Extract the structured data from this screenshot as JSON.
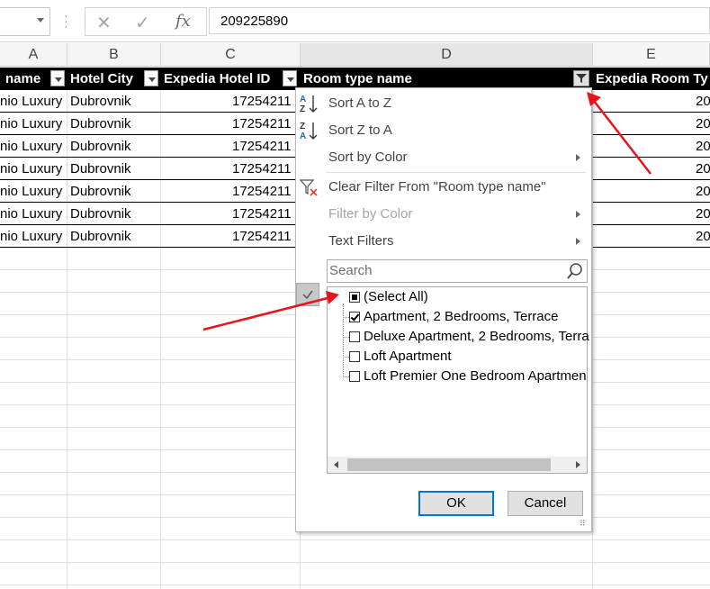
{
  "formula_bar": {
    "name_box_value": "",
    "cancel_icon": "close-icon",
    "enter_icon": "check-icon",
    "fx_label": "fx",
    "content": "209225890"
  },
  "columns": [
    "A",
    "B",
    "C",
    "D",
    "E"
  ],
  "table_headers": {
    "a": "name",
    "b": "Hotel City",
    "c": "Expedia Hotel ID",
    "d": "Room type name",
    "e": "Expedia Room Ty"
  },
  "rows": [
    {
      "a": "nio Luxury",
      "b": "Dubrovnik",
      "c": "17254211",
      "e": "20"
    },
    {
      "a": "nio Luxury",
      "b": "Dubrovnik",
      "c": "17254211",
      "e": "20"
    },
    {
      "a": "nio Luxury",
      "b": "Dubrovnik",
      "c": "17254211",
      "e": "20"
    },
    {
      "a": "nio Luxury",
      "b": "Dubrovnik",
      "c": "17254211",
      "e": "20"
    },
    {
      "a": "nio Luxury",
      "b": "Dubrovnik",
      "c": "17254211",
      "e": "20"
    },
    {
      "a": "nio Luxury",
      "b": "Dubrovnik",
      "c": "17254211",
      "e": "20"
    },
    {
      "a": "nio Luxury",
      "b": "Dubrovnik",
      "c": "17254211",
      "e": "20"
    }
  ],
  "filter_menu": {
    "sort_az": "Sort A to Z",
    "sort_za": "Sort Z to A",
    "sort_by_color": "Sort by Color",
    "clear_filter": "Clear Filter From \"Room type name\"",
    "filter_by_color": "Filter by Color",
    "text_filters": "Text Filters",
    "search_placeholder": "Search",
    "items": [
      {
        "label": "(Select All)",
        "state": "partial"
      },
      {
        "label": "Apartment, 2 Bedrooms, Terrace",
        "state": "checked"
      },
      {
        "label": "Deluxe Apartment, 2 Bedrooms, Terra",
        "state": "unchecked"
      },
      {
        "label": "Loft Apartment",
        "state": "unchecked"
      },
      {
        "label": "Loft Premier One Bedroom Apartmen",
        "state": "unchecked"
      }
    ],
    "ok": "OK",
    "cancel": "Cancel"
  },
  "annotation_color": "#e8141b"
}
